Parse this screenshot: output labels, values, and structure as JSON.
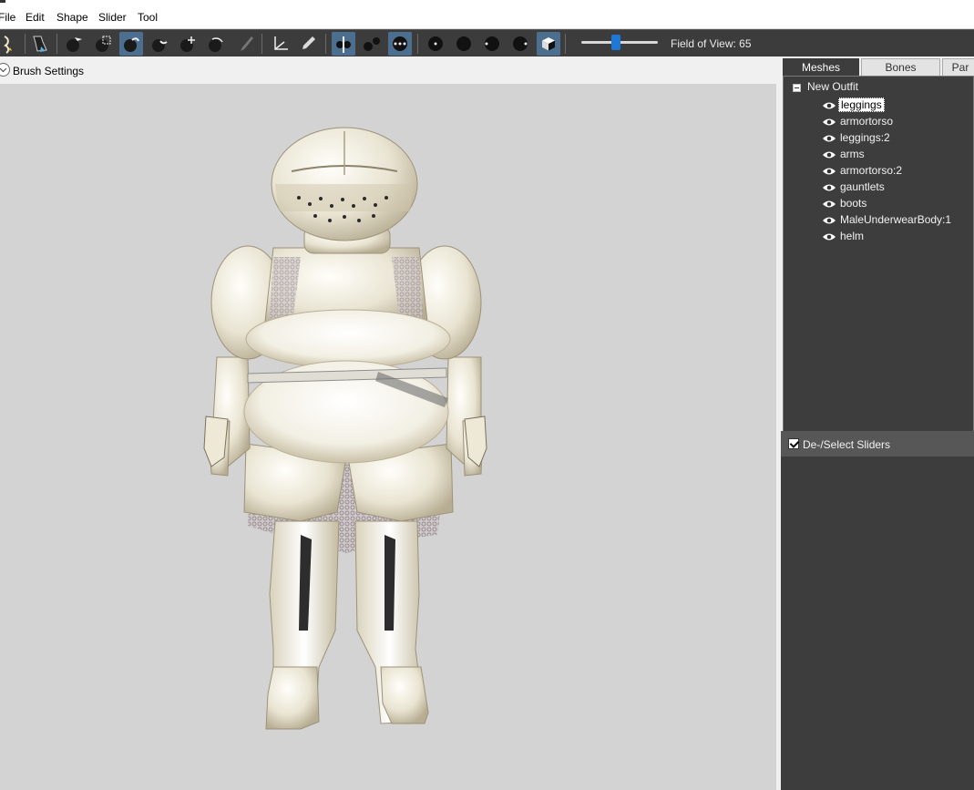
{
  "menu": {
    "file": "File",
    "edit": "Edit",
    "shape": "Shape",
    "slider": "Slider",
    "tool": "Tool"
  },
  "toolbar": {
    "field_of_view_label": "Field of View: 65",
    "field_of_view_value": 65
  },
  "brush_settings": {
    "label": "Brush Settings"
  },
  "tabs": {
    "meshes": "Meshes",
    "bones": "Bones",
    "partitions": "Par"
  },
  "tree": {
    "root": "New Outfit",
    "meshes": [
      {
        "label": "leggings"
      },
      {
        "label": "armortorso"
      },
      {
        "label": "leggings:2"
      },
      {
        "label": "arms"
      },
      {
        "label": "armortorso:2"
      },
      {
        "label": "gauntlets"
      },
      {
        "label": "boots"
      },
      {
        "label": "MaleUnderwearBody:1"
      },
      {
        "label": "helm"
      }
    ]
  },
  "sliders": {
    "select_label": "De-/Select Sliders"
  },
  "colors": {
    "viewport": "#d3d3d3",
    "panel": "#3d3d3d",
    "accent": "#4d6f8f",
    "slider_thumb": "#1e78d6"
  }
}
